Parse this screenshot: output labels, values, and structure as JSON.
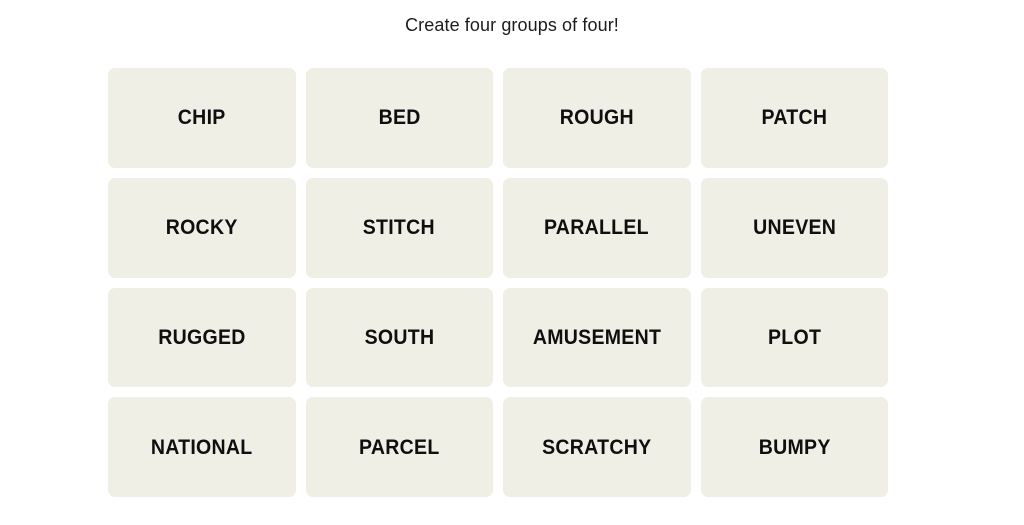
{
  "page": {
    "background_color": "#ffffff"
  },
  "header": {
    "instruction": "Create four groups of four!"
  },
  "board": {
    "rows": 4,
    "columns": 4,
    "tile_background_color": "#efefe6",
    "tile_text_color": "#0f0f0f",
    "tiles": [
      {
        "word": "CHIP"
      },
      {
        "word": "BED"
      },
      {
        "word": "ROUGH"
      },
      {
        "word": "PATCH"
      },
      {
        "word": "ROCKY"
      },
      {
        "word": "STITCH"
      },
      {
        "word": "PARALLEL"
      },
      {
        "word": "UNEVEN"
      },
      {
        "word": "RUGGED"
      },
      {
        "word": "SOUTH"
      },
      {
        "word": "AMUSEMENT"
      },
      {
        "word": "PLOT"
      },
      {
        "word": "NATIONAL"
      },
      {
        "word": "PARCEL"
      },
      {
        "word": "SCRATCHY"
      },
      {
        "word": "BUMPY"
      }
    ]
  }
}
